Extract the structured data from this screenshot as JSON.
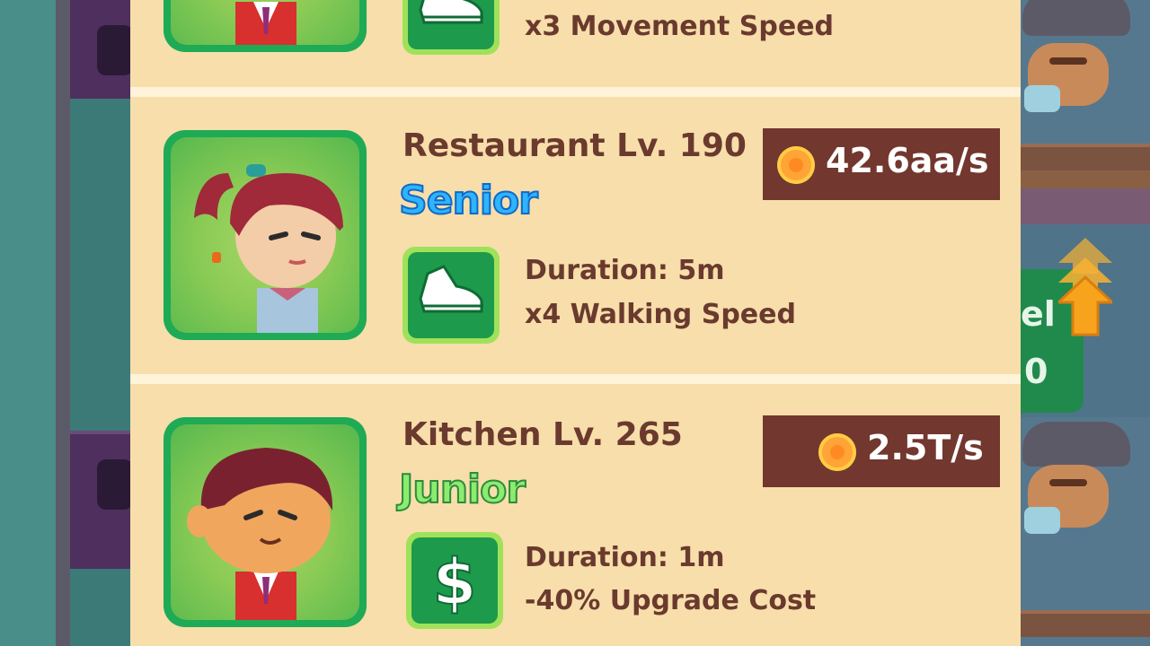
{
  "managers": [
    {
      "title": "",
      "rank": "",
      "rate": "",
      "duration": "",
      "effect": "x3 Movement Speed",
      "skill_icon": "shoe-icon",
      "portrait": "male-manager-red-jacket"
    },
    {
      "title": "Restaurant Lv. 190",
      "rank": "Senior",
      "rate": "42.6aa/s",
      "duration": "Duration: 5m",
      "effect": "x4 Walking Speed",
      "skill_icon": "shoe-icon",
      "portrait": "female-manager-ponytail"
    },
    {
      "title": "Kitchen Lv. 265",
      "rank": "Junior",
      "rate": "2.5T/s",
      "duration": "Duration: 1m",
      "effect": "-40% Upgrade Cost",
      "skill_icon": "dollar-icon",
      "portrait": "male-manager-red-jacket"
    }
  ],
  "background": {
    "sign_text_1": "el",
    "sign_text_2": "0"
  },
  "colors": {
    "panel_bg": "#f7deab",
    "text_brown": "#6a3a2e",
    "rate_bg": "#72372e",
    "senior_blue": "#2fb4ff",
    "junior_green": "#8cec6e",
    "avatar_green": "#1faa55"
  }
}
